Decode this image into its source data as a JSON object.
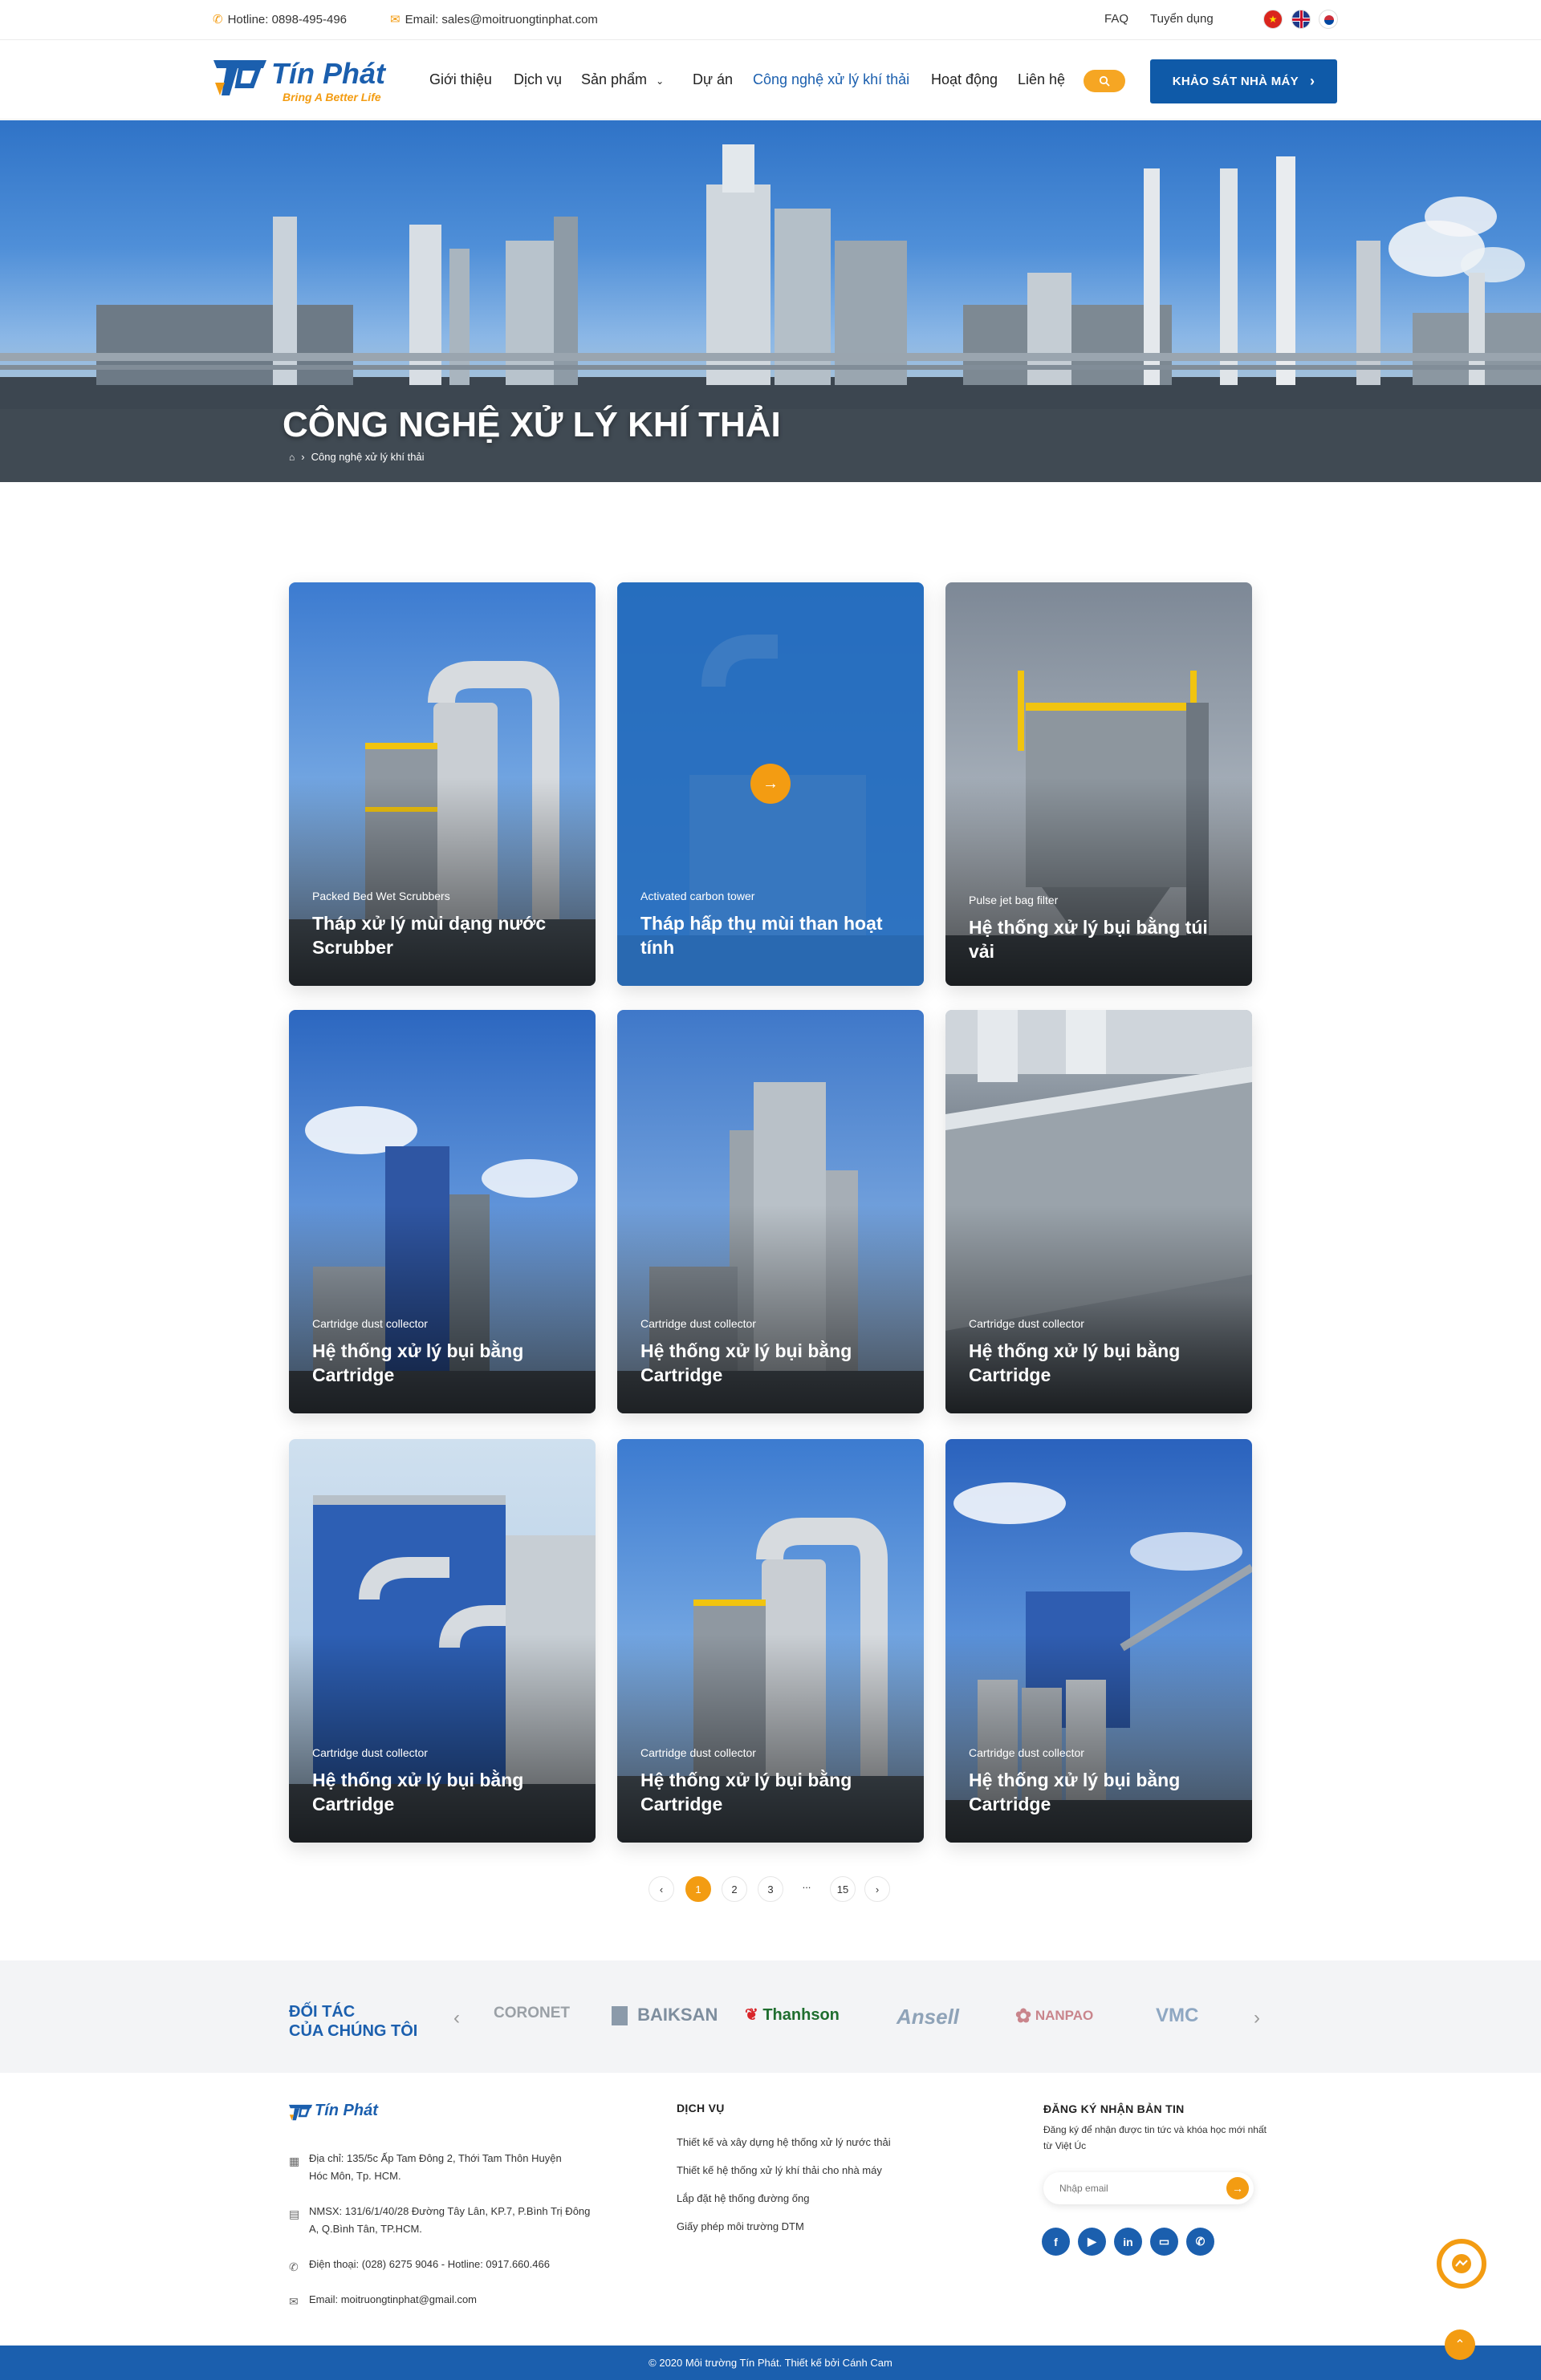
{
  "topbar": {
    "hotline": "Hotline: 0898-495-496",
    "email": "Email: sales@moitruongtinphat.com",
    "faq": "FAQ",
    "careers": "Tuyển dụng"
  },
  "header": {
    "brand_name": "Tín Phát",
    "brand_tagline": "Bring A Better Life",
    "menu": [
      "Giới thiệu",
      "Dịch vụ",
      "Sản phẩm",
      "Dự án",
      "Công nghệ xử lý khí thải",
      "Hoạt động",
      "Liên hệ"
    ],
    "cta": "KHẢO SÁT NHÀ MÁY",
    "colors": {
      "primary": "#1b5fae",
      "accent": "#f39c12"
    }
  },
  "hero": {
    "title": "CÔNG NGHỆ XỬ LÝ KHÍ THẢI",
    "breadcrumb": "Công nghệ xử lý khí thải"
  },
  "cards": [
    {
      "subtitle": "Packed Bed Wet Scrubbers",
      "title": "Tháp xử lý mùi dạng nước Scrubber"
    },
    {
      "subtitle": "Activated carbon tower",
      "title": "Tháp hấp thụ mùi than hoạt tính"
    },
    {
      "subtitle": "Pulse jet bag  filter",
      "title": "Hệ thống xử lý bụi bằng túi vải"
    },
    {
      "subtitle": "Cartridge dust collector",
      "title": "Hệ thống xử lý bụi bằng Cartridge"
    },
    {
      "subtitle": "Cartridge dust collector",
      "title": "Hệ thống xử lý bụi bằng Cartridge"
    },
    {
      "subtitle": "Cartridge dust collector",
      "title": "Hệ thống xử lý bụi bằng Cartridge"
    },
    {
      "subtitle": "Cartridge dust collector",
      "title": "Hệ thống xử lý bụi bằng Cartridge"
    },
    {
      "subtitle": "Cartridge dust collector",
      "title": "Hệ thống xử lý bụi bằng Cartridge"
    },
    {
      "subtitle": "Cartridge dust collector",
      "title": "Hệ thống xử lý bụi bằng Cartridge"
    }
  ],
  "pagination": {
    "pages": [
      "1",
      "2",
      "3",
      "...",
      "15"
    ],
    "current": "1"
  },
  "partners": {
    "heading_1": "ĐỐI TÁC",
    "heading_2": "CỦA CHÚNG TÔI",
    "logos": [
      "CORONET",
      "BAIKSAN",
      "Thanhson",
      "Ansell",
      "NANPAO",
      "VMC"
    ]
  },
  "footer": {
    "brand_name": "Tín Phát",
    "address": "Địa chỉ: 135/5c Ấp Tam Đông 2, Thới Tam Thôn Huyện Hóc Môn, Tp. HCM.",
    "factory": "NMSX: 131/6/1/40/28 Đường Tây Lân, KP.7, P.Bình Trị Đông A, Q.Bình Tân, TP.HCM.",
    "phone": "Điện thoại: (028) 6275 9046 - Hotline: 0917.660.466",
    "email": "Email: moitruongtinphat@gmail.com",
    "services_title": "DỊCH VỤ",
    "services": [
      "Thiết kế và xây dựng hệ thống xử lý nước thải",
      "Thiết kế hệ thống xử lý khí thải cho nhà máy",
      "Lắp đặt hệ thống đường ống",
      "Giấy phép môi trường DTM"
    ],
    "newsletter_title": "ĐĂNG KÝ NHẬN BẢN TIN",
    "newsletter_desc": "Đăng ký để nhận được tin tức và khóa học mới nhất từ Việt Úc",
    "email_placeholder": "Nhập email",
    "social": [
      "facebook-icon",
      "youtube-icon",
      "linkedin-icon",
      "chat-icon",
      "whatsapp-icon"
    ],
    "copyright": "© 2020 Môi trường Tín Phát. Thiết kế bởi Cánh Cam"
  }
}
